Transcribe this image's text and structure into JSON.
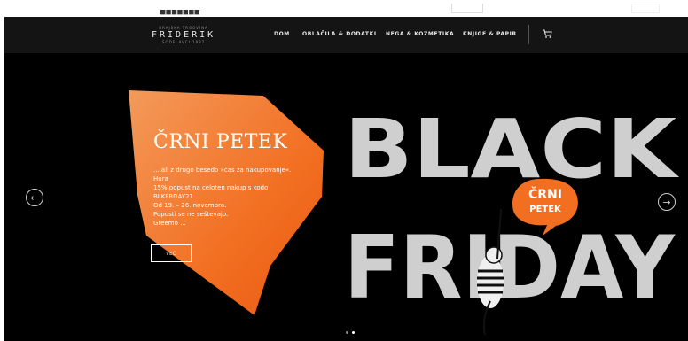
{
  "topbar": {
    "dots": "■■■■■■■"
  },
  "logo": {
    "line1": "BRAJSKA TRGOVINA",
    "name": "FRIDERIK",
    "line3": "SODELAVCI 1887"
  },
  "nav": {
    "items": [
      {
        "label": "DOM"
      },
      {
        "label": "OBLAČILA & DODATKI"
      },
      {
        "label": "NEGA & KOZMETIKA"
      },
      {
        "label": "KNJIGE & PAPIR"
      }
    ]
  },
  "cart": {
    "icon": "cart-icon"
  },
  "hero": {
    "title": "ČRNI PETEK",
    "text": "... ali z drugo besedo »čas za nakupovanje«.\nHura\n15% popust na celoten nakup s kodo\nBLKFRDAY21\nOd 19. – 26. novembra.\nPopusti se ne seštevajo.\nGreemo ...",
    "button_label": "VEČ",
    "banner_line1": "BLACK",
    "banner_line2": "FRIDAY",
    "badge_line1": "ČRNI",
    "badge_line2": "PETEK",
    "prev_icon": "arrow-left-icon",
    "next_icon": "arrow-right-icon"
  },
  "colors": {
    "orange": "#f26f22",
    "orange_light": "#f39a5a",
    "banner_grey": "#cfcfcf",
    "header_bg": "#141414"
  },
  "pager": {
    "count": 2,
    "active": 2
  }
}
